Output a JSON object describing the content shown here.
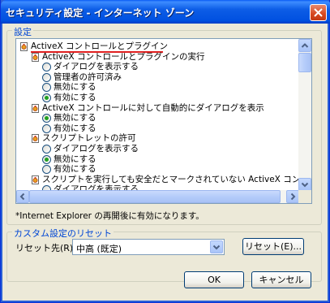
{
  "window": {
    "title": "セキュリティ設定 - インターネット ゾーン",
    "close_label": "×"
  },
  "settings_group": {
    "legend": "設定"
  },
  "tree_items": [
    {
      "kind": "folder",
      "label": "ActiveX コントロールとプラグイン"
    },
    {
      "kind": "setting",
      "label": "ActiveX コントロールとプラグインの実行"
    },
    {
      "kind": "radio",
      "label": "ダイアログを表示する",
      "checked": false
    },
    {
      "kind": "radio",
      "label": "管理者の許可済み",
      "checked": false
    },
    {
      "kind": "radio",
      "label": "無効にする",
      "checked": false
    },
    {
      "kind": "radio",
      "label": "有効にする",
      "checked": true
    },
    {
      "kind": "setting",
      "label": "ActiveX コントロールに対して自動的にダイアログを表示"
    },
    {
      "kind": "radio",
      "label": "無効にする",
      "checked": true
    },
    {
      "kind": "radio",
      "label": "有効にする",
      "checked": false
    },
    {
      "kind": "setting",
      "label": "スクリプトレットの許可"
    },
    {
      "kind": "radio",
      "label": "ダイアログを表示する",
      "checked": false
    },
    {
      "kind": "radio",
      "label": "無効にする",
      "checked": true
    },
    {
      "kind": "radio",
      "label": "有効にする",
      "checked": false
    },
    {
      "kind": "setting",
      "label": "スクリプトを実行しても安全だとマークされていない ActiveX コントロールの初期"
    },
    {
      "kind": "radio",
      "label": "ダイアログを表示する",
      "checked": false
    }
  ],
  "note": "*Internet Explorer の再開後に有効になります。",
  "reset_group": {
    "legend": "カスタム設定のリセット",
    "label": "リセット先(R):",
    "selected": "中高 (既定)",
    "reset_button": "リセット(E)..."
  },
  "footer": {
    "ok": "OK",
    "cancel": "キャンセル"
  },
  "colors": {
    "title_bar": "#0054e3",
    "group_legend": "#0046d5",
    "radio_dot": "#21a121",
    "annotation": "#e02020"
  }
}
